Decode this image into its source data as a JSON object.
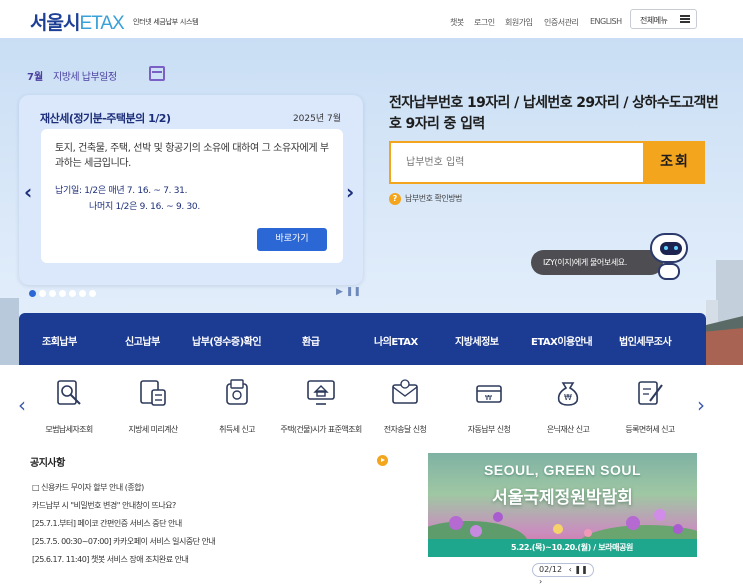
{
  "header": {
    "logo_main": "서울시",
    "logo_etax": "ETAX",
    "logo_sub": "인터넷 세금납부 시스템",
    "links": [
      "챗봇",
      "로그인",
      "회원가입",
      "인증서관리",
      "ENGLISH"
    ],
    "menu_button": "전체메뉴"
  },
  "hero": {
    "month": "7월",
    "schedule_label": "지방세 납부일정",
    "card": {
      "title": "재산세(정기분-주택분의 1/2)",
      "year": "2025년 7월",
      "description": "토지, 건축물, 주택, 선박 및 항공기의 소유에 대하여 그 소유자에게 부과하는 세금입니다.",
      "pay_line1": "납기일: 1/2은 매년 7. 16. ~ 7. 31.",
      "pay_line2": "나머지 1/2은 9. 16. ~ 9. 30.",
      "go_button": "바로가기"
    },
    "slide_count": 7,
    "active_slide": 0
  },
  "search": {
    "title": "전자납부번호 19자리 / 납세번호 29자리 / 상하수도고객번호 9자리 중 입력",
    "placeholder": "납부번호 입력",
    "button": "조회",
    "help_icon": "?",
    "help": "납부번호 확인방법",
    "chatbot_bubble": "IZY(이지)에게 물어보세요."
  },
  "nav": {
    "items": [
      "조회납부",
      "신고납부",
      "납부(영수증)확인",
      "환급",
      "나의ETAX",
      "지방세정보",
      "ETAX이용안내",
      "법인세무조사"
    ]
  },
  "services": {
    "items": [
      {
        "label": "모범납세자조회",
        "icon": "search-doc-icon"
      },
      {
        "label": "지방세 미리계산",
        "icon": "calculator-icon"
      },
      {
        "label": "취득세 신고",
        "icon": "wallet-icon"
      },
      {
        "label": "주택(건물)시가 표준액조회",
        "icon": "monitor-house-icon"
      },
      {
        "label": "전자송달 신청",
        "icon": "email-icon"
      },
      {
        "label": "자동납부 신청",
        "icon": "card-icon"
      },
      {
        "label": "은닉재산 신고",
        "icon": "money-bag-icon"
      },
      {
        "label": "등록면허세 신고",
        "icon": "pen-doc-icon"
      }
    ]
  },
  "notice": {
    "title": "공지사항",
    "items": [
      "□ 신용카드 무이자 할부 안내 (종합)",
      "카드납부 시 \"비밀번호 변경\" 안내창이 뜨나요?",
      "[25.7.1.부터] 페이코 간편인증 서비스 중단 안내",
      "[25.7.5. 00:30~07:00] 카카오페이 서비스 일시중단 안내",
      "[25.6.17. 11:40] 챗봇 서비스 장애 조치완료 안내"
    ]
  },
  "banner": {
    "en": "SEOUL, GREEN SOUL",
    "ko": "서울국제정원박람회",
    "dates": "5.22.(목)~10.20.(월) / 보라매공원",
    "pager": "02/12"
  }
}
